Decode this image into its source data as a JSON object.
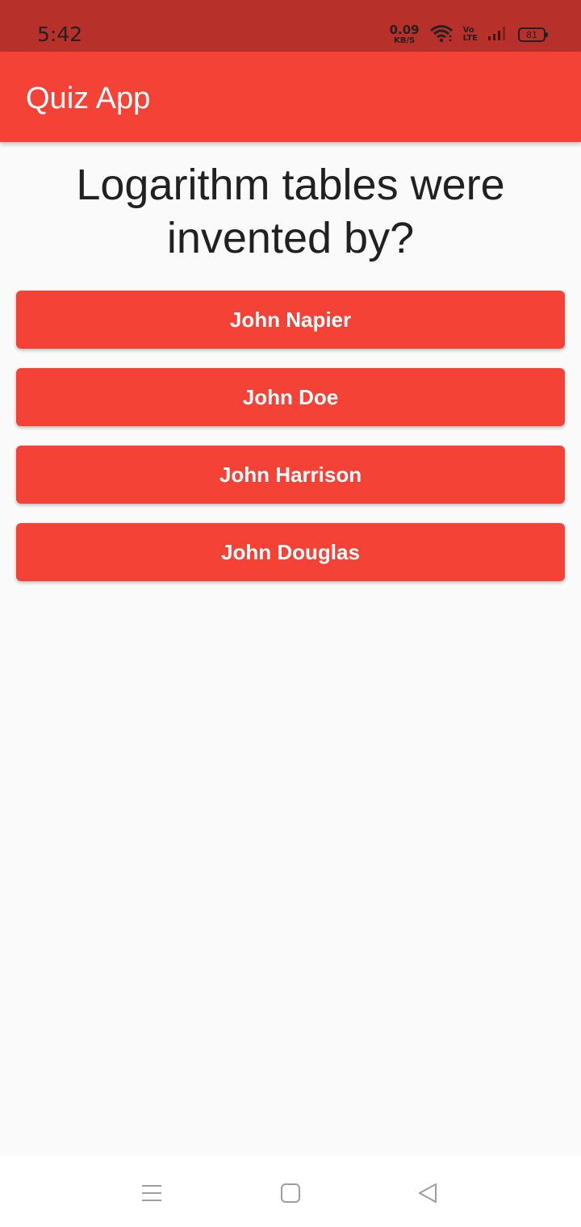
{
  "status_bar": {
    "time": "5:42",
    "net_speed_value": "0.09",
    "net_speed_unit": "KB/S",
    "volte_top": "Vo",
    "volte_bottom": "LTE",
    "battery": "81",
    "icons": [
      "wifi-icon",
      "volte-icon",
      "signal-icon",
      "battery-icon"
    ]
  },
  "app_bar": {
    "title": "Quiz App",
    "color": "#f44336"
  },
  "quiz": {
    "question": "Logarithm tables were invented by?",
    "answers": [
      {
        "label": "John Napier"
      },
      {
        "label": "John Doe"
      },
      {
        "label": "John Harrison"
      },
      {
        "label": "John Douglas"
      }
    ],
    "button_color": "#f44336"
  },
  "nav_bar": {
    "icons": [
      "menu-icon",
      "home-icon",
      "back-icon"
    ]
  }
}
